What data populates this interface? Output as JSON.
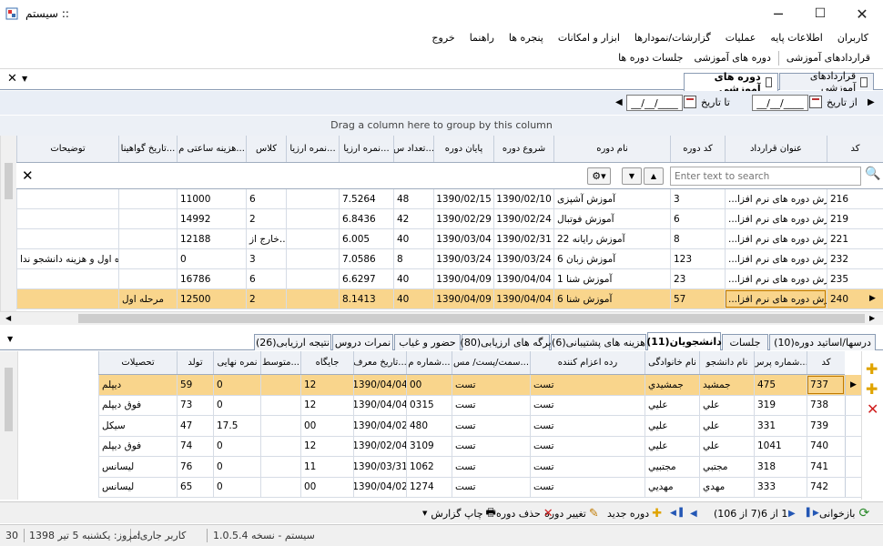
{
  "window": {
    "title": "سیستم ::",
    "minimize": "─",
    "maximize": "☐",
    "close": "✕"
  },
  "menu": [
    "کاربران",
    "اطلاعات پایه",
    "عملیات",
    "گزارشات/نمودارها",
    "ابزار و امکانات",
    "پنجره ها",
    "راهنما",
    "خروج"
  ],
  "toolstrip": [
    "قراردادهای آموزشی",
    "دوره های آموزشی",
    "جلسات دوره ها"
  ],
  "doc_tabs": {
    "active": "دوره های آموزشی",
    "other": "قراردادهای آموزشی"
  },
  "filter": {
    "from_label": "از تاریخ",
    "to_label": "تا تاریخ",
    "from_value": "__/__/____",
    "to_value": "__/__/____"
  },
  "top_grid": {
    "group_hint": "Drag a column here to group by this column",
    "search_placeholder": "Enter text to search",
    "columns": [
      "کد",
      "عنوان قرارداد",
      "کد دوره",
      "نام دوره",
      "شروع دوره",
      "پایان دوره",
      "تعداد س...",
      "نمره ارزیا...",
      "نمره ارزیا...",
      "کلاس",
      "هزینه ساعتی م...",
      "تاریخ گواهینا...",
      "توضیحات"
    ],
    "rows": [
      {
        "code": "216",
        "contract": "آموزش دوره های نرم افزا...",
        "course_code": "3",
        "course": "آموزش آشپزی",
        "start": "1390/02/10",
        "end": "1390/02/15",
        "count": "48",
        "score1": "7.5264",
        "score2": "",
        "class": "6",
        "cost": "11000",
        "cert": "",
        "notes": ""
      },
      {
        "code": "219",
        "contract": "آموزش دوره های نرم افزا...",
        "course_code": "6",
        "course": "آموزش فوتبال",
        "start": "1390/02/24",
        "end": "1390/02/29",
        "count": "42",
        "score1": "6.8436",
        "score2": "",
        "class": "2",
        "cost": "14992",
        "cert": "",
        "notes": ""
      },
      {
        "code": "221",
        "contract": "آموزش دوره های نرم افزا...",
        "course_code": "8",
        "course": "آموزش رایانه 22",
        "start": "1390/02/31",
        "end": "1390/03/04",
        "count": "40",
        "score1": "6.005",
        "score2": "",
        "class": "خارج از...",
        "cost": "12188",
        "cert": "",
        "notes": ""
      },
      {
        "code": "232",
        "contract": "آموزش دوره های نرم افزا...",
        "course_code": "123",
        "course": "آموزش زبان 6",
        "start": "1390/03/24",
        "end": "1390/03/24",
        "count": "8",
        "score1": "7.0586",
        "score2": "",
        "class": "3",
        "cost": "0",
        "cert": "",
        "notes": "دوره اول و هزینه دانشجو ندا"
      },
      {
        "code": "235",
        "contract": "آموزش دوره های نرم افزا...",
        "course_code": "23",
        "course": "آموزش شنا 1",
        "start": "1390/04/04",
        "end": "1390/04/09",
        "count": "40",
        "score1": "6.6297",
        "score2": "",
        "class": "6",
        "cost": "16786",
        "cert": "",
        "notes": ""
      },
      {
        "code": "240",
        "contract": "آموزش دوره های نرم افزا...",
        "course_code": "57",
        "course": "آموزش شنا 6",
        "start": "1390/04/04",
        "end": "1390/04/09",
        "count": "40",
        "score1": "8.1413",
        "score2": "",
        "class": "2",
        "cost": "12500",
        "cert": "مرحله اول",
        "notes": ""
      }
    ]
  },
  "detail_tabs": [
    "درسها/اساتید دوره(10)",
    "جلسات",
    "دانشجویان(11)",
    "هزینه های پشتیبانی(6)",
    "برگه های ارزیابی(80)",
    "حضور و غیاب",
    "نمرات دروس",
    "نتیجه ارزیابی(26)"
  ],
  "bottom_grid": {
    "columns": [
      "کد",
      "شماره پرس...",
      "نام دانشجو",
      "نام خانوادگی",
      "رده اعزام کننده",
      "سمت/پست/ مس...",
      "شماره م...",
      "تاریخ معرف...",
      "جایگاه",
      "متوسط...",
      "نمره نهایی",
      "تولد",
      "تحصیلات"
    ],
    "rows": [
      {
        "code": "737",
        "pers": "475",
        "name": "جمشيد",
        "family": "جمشيدي",
        "rank": "تست",
        "post": "تست",
        "num": "00",
        "date": "1390/04/04",
        "place": "12",
        "avg": "",
        "final": "0",
        "birth": "59",
        "edu": "ديپلم"
      },
      {
        "code": "738",
        "pers": "319",
        "name": "علي",
        "family": "عليي",
        "rank": "تست",
        "post": "تست",
        "num": "0315",
        "date": "1390/04/04",
        "place": "12",
        "avg": "",
        "final": "0",
        "birth": "73",
        "edu": "فوق ديپلم"
      },
      {
        "code": "739",
        "pers": "331",
        "name": "علي",
        "family": "عليي",
        "rank": "تست",
        "post": "تست",
        "num": "480",
        "date": "1390/04/02",
        "place": "00",
        "avg": "",
        "final": "17.5",
        "birth": "47",
        "edu": "سيكل"
      },
      {
        "code": "740",
        "pers": "1041",
        "name": "علي",
        "family": "عليي",
        "rank": "تست",
        "post": "تست",
        "num": "3109",
        "date": "1390/02/04",
        "place": "12",
        "avg": "",
        "final": "0",
        "birth": "74",
        "edu": "فوق ديپلم"
      },
      {
        "code": "741",
        "pers": "318",
        "name": "مجتبي",
        "family": "مجتبيي",
        "rank": "تست",
        "post": "تست",
        "num": "1062",
        "date": "1390/03/31",
        "place": "11",
        "avg": "",
        "final": "0",
        "birth": "76",
        "edu": "ليسانس"
      },
      {
        "code": "742",
        "pers": "333",
        "name": "مهدي",
        "family": "مهديي",
        "rank": "تست",
        "post": "تست",
        "num": "1274",
        "date": "1390/04/02",
        "place": "00",
        "avg": "",
        "final": "0",
        "birth": "65",
        "edu": "ليسانس"
      }
    ]
  },
  "bottom_toolbar": {
    "refresh": "بازخوانی",
    "nav_text": "1 از 6(7 از 106)",
    "new": "دوره جدید",
    "edit": "تغییر دوره",
    "delete": "حذف دوره",
    "print": "چاپ گزارش"
  },
  "status": {
    "app": "سیستم - نسخه 1.0.5.4",
    "user_label": "کاربر جاری:",
    "today": "امروز: یکشنبه 5 تیر 1398",
    "number": "30"
  },
  "colors": {
    "selected_row": "#f9d58c",
    "header": "#eef1f6",
    "accent_border": "#8a9bb3"
  }
}
